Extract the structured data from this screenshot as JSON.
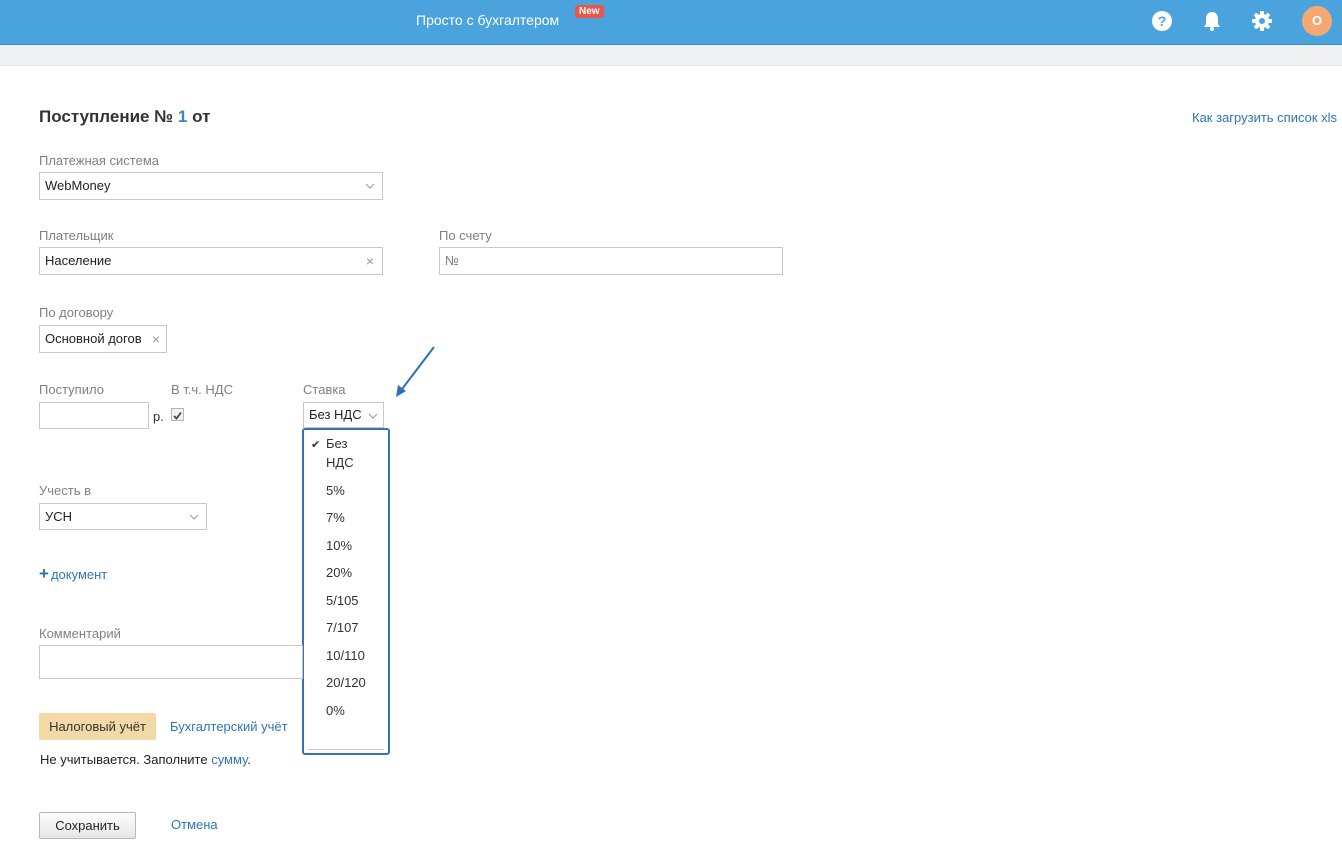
{
  "header": {
    "brand": "Просто с бухгалтером",
    "badge": "New",
    "avatar_letter": "О",
    "icons": [
      "help-icon",
      "bell-icon",
      "gear-icon"
    ],
    "accent_color": "#4aa3dc"
  },
  "page": {
    "title_prefix": "Поступление №",
    "title_number": "1",
    "title_suffix": "от",
    "xls_link": "Как загрузить список xls"
  },
  "form": {
    "payment_system": {
      "label": "Платежная система",
      "value": "WebMoney"
    },
    "payer": {
      "label": "Плательщик",
      "value": "Население"
    },
    "invoice": {
      "label": "По счету",
      "placeholder": "№"
    },
    "contract": {
      "label": "По договору",
      "value": "Основной догов"
    },
    "received": {
      "label": "Поступило",
      "value": "",
      "currency": "р."
    },
    "vat_included": {
      "label": "В т.ч. НДС",
      "checked": true
    },
    "rate": {
      "label": "Ставка",
      "value": "Без НДС",
      "options": [
        "Без НДС",
        "5%",
        "7%",
        "10%",
        "20%",
        "5/105",
        "7/107",
        "10/110",
        "20/120",
        "0%"
      ],
      "selected": "Без НДС"
    },
    "account_in": {
      "label": "Учесть в",
      "value": "УСН"
    },
    "add_document": "документ",
    "comment": {
      "label": "Комментарий",
      "value": ""
    }
  },
  "tabs": {
    "tax": "Налоговый учёт",
    "accounting": "Бухгалтерский учёт"
  },
  "note": {
    "text": "Не учитывается. Заполните",
    "link": "сумму",
    "end": "."
  },
  "actions": {
    "save": "Сохранить",
    "cancel": "Отмена"
  }
}
